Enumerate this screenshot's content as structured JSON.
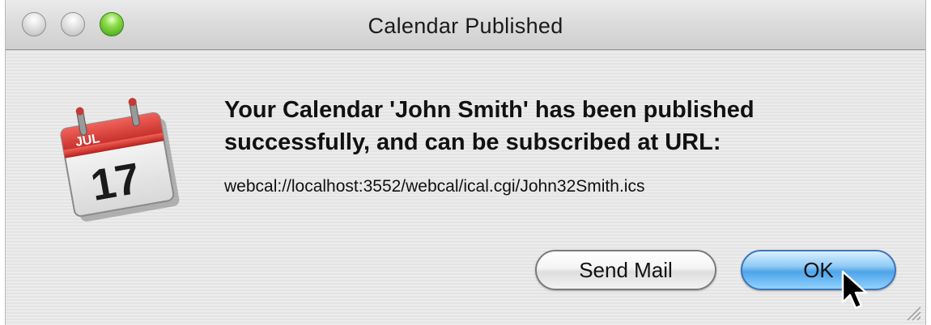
{
  "window": {
    "title": "Calendar Published"
  },
  "icon": {
    "month": "JUL",
    "day": "17"
  },
  "message": {
    "headline": "Your Calendar 'John Smith' has been published successfully, and can be subscribed at URL:",
    "url": "webcal://localhost:3552/webcal/ical.cgi/John32Smith.ics"
  },
  "buttons": {
    "send_mail_label": "Send Mail",
    "ok_label": "OK"
  },
  "colors": {
    "ok_accent": "#4ea4e8",
    "calendar_red": "#d8332d"
  }
}
